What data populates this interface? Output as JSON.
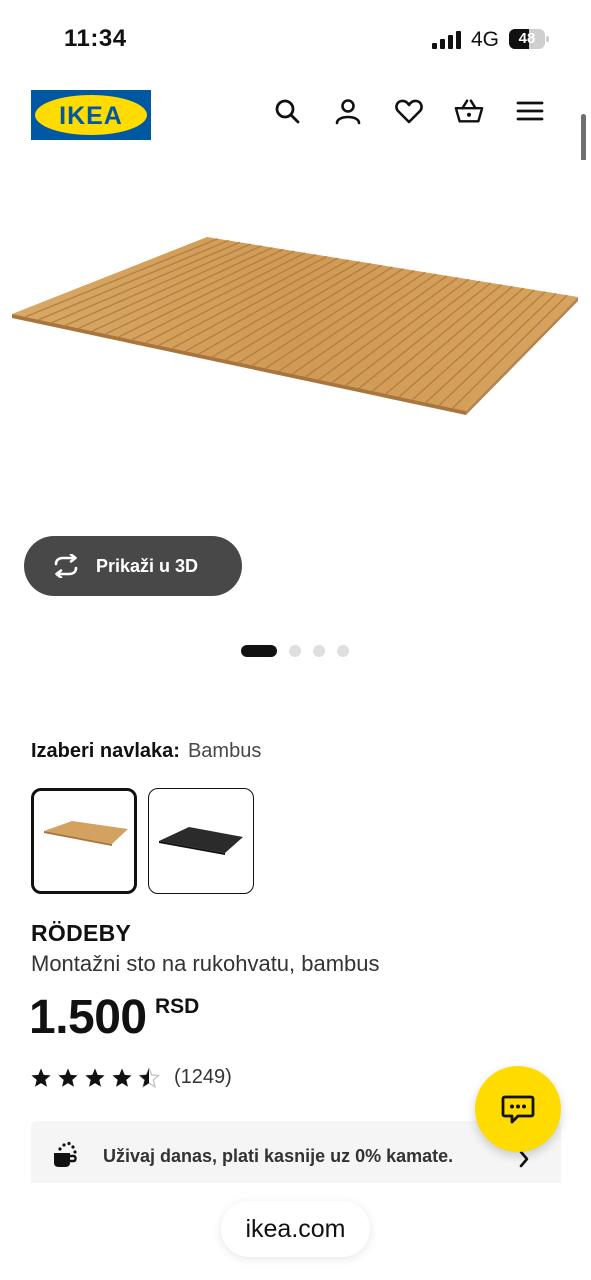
{
  "status_bar": {
    "time": "11:34",
    "network": "4G",
    "battery": "48"
  },
  "header": {
    "logo_text": "IKEA",
    "icons": [
      "search-icon",
      "user-icon",
      "heart-icon",
      "basket-icon",
      "menu-icon"
    ]
  },
  "gallery": {
    "view_3d_label": "Prikaži u 3D",
    "dots": 4,
    "active_dot": 1
  },
  "variant": {
    "label": "Izaberi navlaka:",
    "selected": "Bambus"
  },
  "product": {
    "name": "RÖDEBY",
    "description": "Montažni sto na rukohvatu, bambus",
    "price": "1.500",
    "currency": "RSD",
    "rating": 4.5,
    "review_count": "(1249)"
  },
  "promo": {
    "text": "Uživaj danas, plati kasnije uz 0% kamate."
  },
  "browser": {
    "url": "ikea.com"
  },
  "colors": {
    "ikea_blue": "#0058a3",
    "ikea_yellow": "#ffdb00",
    "bamboo": "#d4a260",
    "dark_button": "#484848"
  }
}
